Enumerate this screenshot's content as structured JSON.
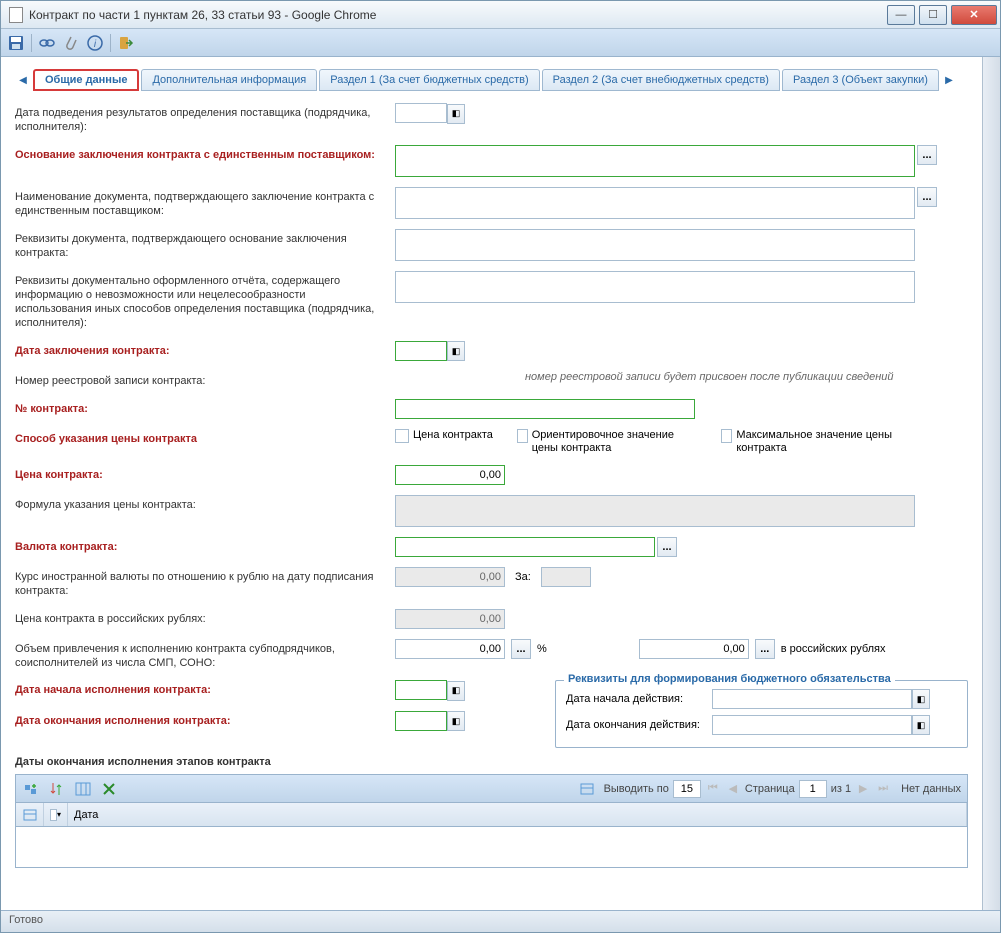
{
  "window": {
    "title": "Контракт по части 1 пунктам 26, 33 статьи 93 - Google Chrome"
  },
  "tabs": {
    "t1": "Общие данные",
    "t2": "Дополнительная информация",
    "t3": "Раздел 1 (За счет бюджетных средств)",
    "t4": "Раздел 2 (За счет внебюджетных средств)",
    "t5": "Раздел 3 (Объект закупки)"
  },
  "labels": {
    "result_date": "Дата подведения результатов определения поставщика (подрядчика, исполнителя):",
    "basis": "Основание заключения контракта с единственным поставщиком:",
    "doc_name": "Наименование документа, подтверждающего заключение контракта с единственным поставщиком:",
    "doc_req": "Реквизиты документа, подтверждающего основание заключения контракта:",
    "report_req": "Реквизиты документально оформленного отчёта, содержащего информацию о невозможности или нецелесообразности использования иных способов определения поставщика (подрядчика, исполнителя):",
    "contract_date": "Дата заключения контракта:",
    "reg_number": "Номер реестровой записи контракта:",
    "reg_help": "номер реестровой записи будет присвоен после публикации сведений",
    "contract_no": "№ контракта:",
    "price_method": "Способ указания цены контракта",
    "price": "Цена контракта:",
    "price_formula": "Формула указания цены контракта:",
    "currency": "Валюта контракта:",
    "rate": "Курс иностранной валюты по отношению к рублю на дату подписания контракта:",
    "price_rub": "Цена контракта в российских рублях:",
    "smp": "Объем привлечения к исполнению контракта субподрядчиков, соисполнителей из числа СМП, СОНО:",
    "start_date": "Дата начала исполнения контракта:",
    "end_date": "Дата окончания исполнения контракта:",
    "stages": "Даты окончания исполнения этапов контракта",
    "za": "За:",
    "pct": "%",
    "rub_suffix": "в российских рублях"
  },
  "checks": {
    "c1": "Цена контракта",
    "c2": "Ориентировочное значение цены контракта",
    "c3": "Максимальное значение цены контракта"
  },
  "values": {
    "price": "0,00",
    "rate": "0,00",
    "price_rub": "0,00",
    "smp_pct": "0,00",
    "smp_rub": "0,00"
  },
  "budget": {
    "title": "Реквизиты для формирования бюджетного обязательства",
    "start": "Дата начала действия:",
    "end": "Дата окончания действия:"
  },
  "grid": {
    "show_by": "Выводить по",
    "show_val": "15",
    "page": "Страница",
    "page_val": "1",
    "of": "из 1",
    "nodata": "Нет данных",
    "col_date": "Дата"
  },
  "status": "Готово"
}
